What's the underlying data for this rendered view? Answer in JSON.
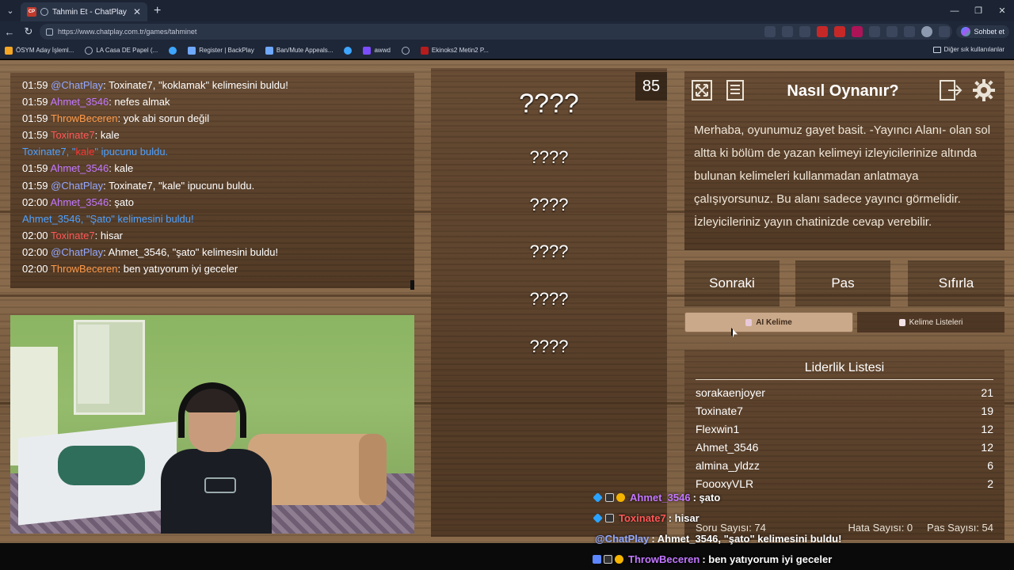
{
  "browser": {
    "tab_title": "Tahmin Et - ChatPlay",
    "tab_fav": "CP",
    "url": "https://www.chatplay.com.tr/games/tahminet",
    "sohbet": "Sohbet et",
    "bookmarks": [
      "ÖSYM Aday İşleml...",
      "LA Casa DE Papel (...",
      "",
      "Register | BackPlay",
      "Ban/Mute Appeals...",
      "",
      "awwd",
      "",
      "Ekinoks2 Metin2 P..."
    ],
    "other_bookmarks": "Diğer sık kullanılanlar"
  },
  "chat_log": [
    {
      "time": "01:59",
      "user": "@ChatPlay",
      "color": "chatplay",
      "msg": "Toxinate7, \"koklamak\" kelimesini buldu!"
    },
    {
      "time": "01:59",
      "user": "Ahmet_3546",
      "color": "ahmet",
      "msg": "nefes almak"
    },
    {
      "time": "01:59",
      "user": "ThrowBeceren",
      "color": "throw",
      "msg": "yok abi sorun değil"
    },
    {
      "time": "01:59",
      "user": "Toxinate7",
      "color": "toxi",
      "msg": "kale"
    },
    {
      "system": true,
      "pre": "Toxinate7, \"",
      "hl": "kale",
      "post": "\" ipucunu buldu."
    },
    {
      "time": "01:59",
      "user": "Ahmet_3546",
      "color": "ahmet",
      "msg": "kale"
    },
    {
      "time": "01:59",
      "user": "@ChatPlay",
      "color": "chatplay",
      "msg": "Toxinate7, \"kale\" ipucunu buldu."
    },
    {
      "time": "02:00",
      "user": "Ahmet_3546",
      "color": "ahmet",
      "msg": "şato"
    },
    {
      "system": true,
      "pre": "Ahmet_3546, \"Şato\" kelimesini buldu!",
      "hl": "",
      "post": ""
    },
    {
      "time": "02:00",
      "user": "Toxinate7",
      "color": "toxi",
      "msg": "hisar"
    },
    {
      "time": "02:00",
      "user": "@ChatPlay",
      "color": "chatplay",
      "msg": "Ahmet_3546, \"şato\" kelimesini buldu!"
    },
    {
      "time": "02:00",
      "user": "ThrowBeceren",
      "color": "throw",
      "msg": "ben yatıyorum iyi geceler"
    }
  ],
  "words": {
    "counter": "85",
    "main": "????",
    "hidden": [
      "????",
      "????",
      "????",
      "????",
      "????"
    ]
  },
  "howto": {
    "title": "Nasıl Oynanır?",
    "body": "Merhaba, oyunumuz gayet basit. -Yayıncı Alanı- olan sol altta ki bölüm de yazan kelimeyi izleyicilerinize altında bulunan kelimeleri kullanmadan anlatmaya çalışıyorsunuz. Bu alanı sadece yayıncı görmelidir. İzleyicileriniz yayın chatinizde cevap verebilir."
  },
  "buttons": {
    "next": "Sonraki",
    "pass": "Pas",
    "reset": "Sıfırla",
    "ai_word": "AI Kelime",
    "word_lists": "Kelime Listeleri"
  },
  "leaderboard": {
    "title": "Liderlik Listesi",
    "rows": [
      {
        "name": "sorakaenjoyer",
        "score": "21"
      },
      {
        "name": "Toxinate7",
        "score": "19"
      },
      {
        "name": "Flexwin1",
        "score": "12"
      },
      {
        "name": "Ahmet_3546",
        "score": "12"
      },
      {
        "name": "almina_yldzz",
        "score": "6"
      },
      {
        "name": "FoooxyVLR",
        "score": "2"
      }
    ],
    "question_count": "Soru Sayısı: 74",
    "error_count": "Hata Sayısı: 0",
    "pass_count": "Pas Sayısı: 54"
  },
  "overlay_chat": [
    {
      "name": "Ahmet_3546",
      "msg": ": şato",
      "cls": "ahmet"
    },
    {
      "name": "Toxinate7",
      "msg": ": hisar",
      "cls": "toxi"
    },
    {
      "name": "@ChatPlay",
      "msg": ": Ahmet_3546, \"şato\" kelimesini buldu!",
      "cls": "chat"
    },
    {
      "name": "ThrowBeceren",
      "msg": ": ben yatıyorum iyi geceler",
      "cls": "throw"
    }
  ]
}
